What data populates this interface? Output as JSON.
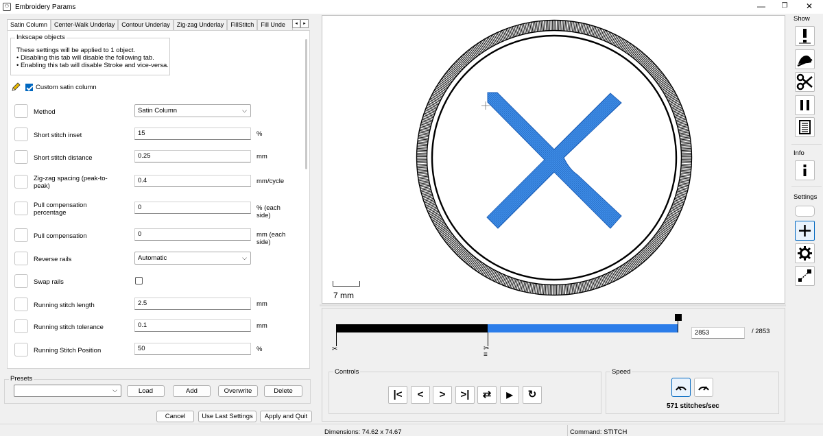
{
  "window": {
    "title": "Embroidery Params",
    "minimize": "—",
    "restore": "❐",
    "close": "✕"
  },
  "tabs": [
    "Satin Column",
    "Center-Walk Underlay",
    "Contour Underlay",
    "Zig-zag Underlay",
    "FillStitch",
    "Fill Unde"
  ],
  "tab_arrows": [
    "◂",
    "▸"
  ],
  "inkscape": {
    "legend": "Inkscape objects",
    "line1": "These settings will be applied to 1 object.",
    "line2": "• Disabling this tab will disable the following tab.",
    "line3": "• Enabling this tab will disable Stroke and vice-versa."
  },
  "custom_label": "Custom satin column",
  "params": [
    {
      "label": "Method",
      "type": "select",
      "value": "Satin Column",
      "unit": ""
    },
    {
      "label": "Short stitch inset",
      "type": "input",
      "value": "15",
      "unit": "%"
    },
    {
      "label": "Short stitch distance",
      "type": "input",
      "value": "0.25",
      "unit": "mm"
    },
    {
      "label": "Zig-zag spacing (peak-to-peak)",
      "type": "input",
      "value": "0.4",
      "unit": "mm/cycle"
    },
    {
      "label": "Pull compensation percentage",
      "type": "input",
      "value": "0",
      "unit": "% (each side)"
    },
    {
      "label": "Pull compensation",
      "type": "input",
      "value": "0",
      "unit": "mm (each side)"
    },
    {
      "label": "Reverse rails",
      "type": "select",
      "value": "Automatic",
      "unit": ""
    },
    {
      "label": "Swap rails",
      "type": "checkbox",
      "value": "",
      "unit": ""
    },
    {
      "label": "Running stitch length",
      "type": "input",
      "value": "2.5",
      "unit": "mm"
    },
    {
      "label": "Running stitch tolerance",
      "type": "input",
      "value": "0.1",
      "unit": "mm"
    },
    {
      "label": "Running Stitch Position",
      "type": "input",
      "value": "50",
      "unit": "%"
    }
  ],
  "presets": {
    "legend": "Presets",
    "load": "Load",
    "add": "Add",
    "overwrite": "Overwrite",
    "delete": "Delete"
  },
  "footer": {
    "cancel": "Cancel",
    "use_last": "Use Last Settings",
    "apply": "Apply and Quit"
  },
  "preview": {
    "scale_label": "7 mm",
    "stitch_color": "#2b7de9"
  },
  "slider": {
    "current": "2853",
    "total": "/ 2853",
    "progress": 1.0
  },
  "controls": {
    "legend": "Controls",
    "buttons": [
      "|<",
      "<",
      ">",
      ">|",
      "⇄",
      "▶",
      "↻"
    ]
  },
  "speed": {
    "legend": "Speed",
    "text": "571 stitches/sec"
  },
  "status": {
    "dimensions": "Dimensions: 74.62 x 74.67",
    "command": "Command: STITCH"
  },
  "sidebar": {
    "show": "Show",
    "info": "Info",
    "settings": "Settings"
  }
}
